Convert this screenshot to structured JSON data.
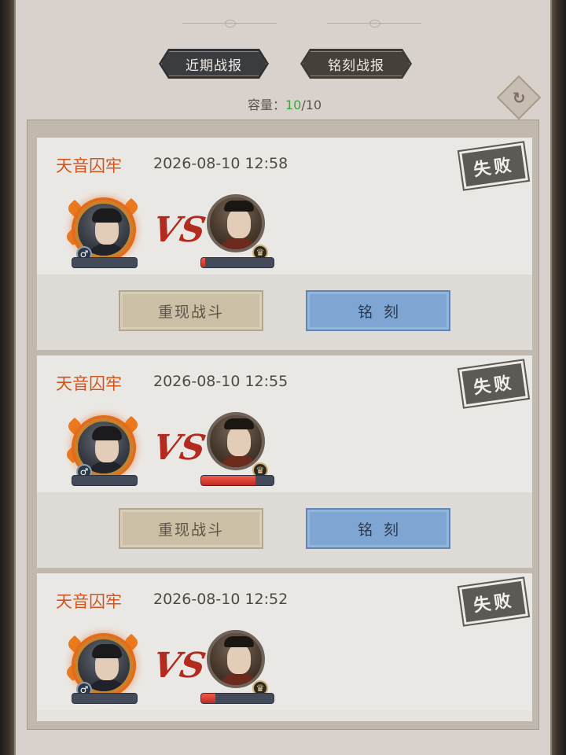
{
  "tabs": [
    {
      "label": "近期战报",
      "active": false
    },
    {
      "label": "铭刻战报",
      "active": true
    }
  ],
  "capacity": {
    "label": "容量：",
    "current": "10",
    "separator": "/",
    "max": "10"
  },
  "refresh_icon": "refresh-icon",
  "records": [
    {
      "name": "天音囚牢",
      "time": "2026-08-10 12:58",
      "result": "失败",
      "vs": "VS",
      "player_hp": 0,
      "enemy_hp": 0.05,
      "replay_label": "重现战斗",
      "engrave_label": "铭刻"
    },
    {
      "name": "天音囚牢",
      "time": "2026-08-10 12:55",
      "result": "失败",
      "vs": "VS",
      "player_hp": 0,
      "enemy_hp": 0.75,
      "replay_label": "重现战斗",
      "engrave_label": "铭刻"
    },
    {
      "name": "天音囚牢",
      "time": "2026-08-10 12:52",
      "result": "失败",
      "vs": "VS",
      "player_hp": 0,
      "enemy_hp": 0.2,
      "replay_label": "重现战斗",
      "engrave_label": "铭刻"
    }
  ],
  "colors": {
    "record_name": "#d2541d",
    "capacity_current": "#3fa33a",
    "engrave_button": "#7fa6d2",
    "replay_button": "#cbbfa5",
    "hp_fill": "#e0443a"
  }
}
